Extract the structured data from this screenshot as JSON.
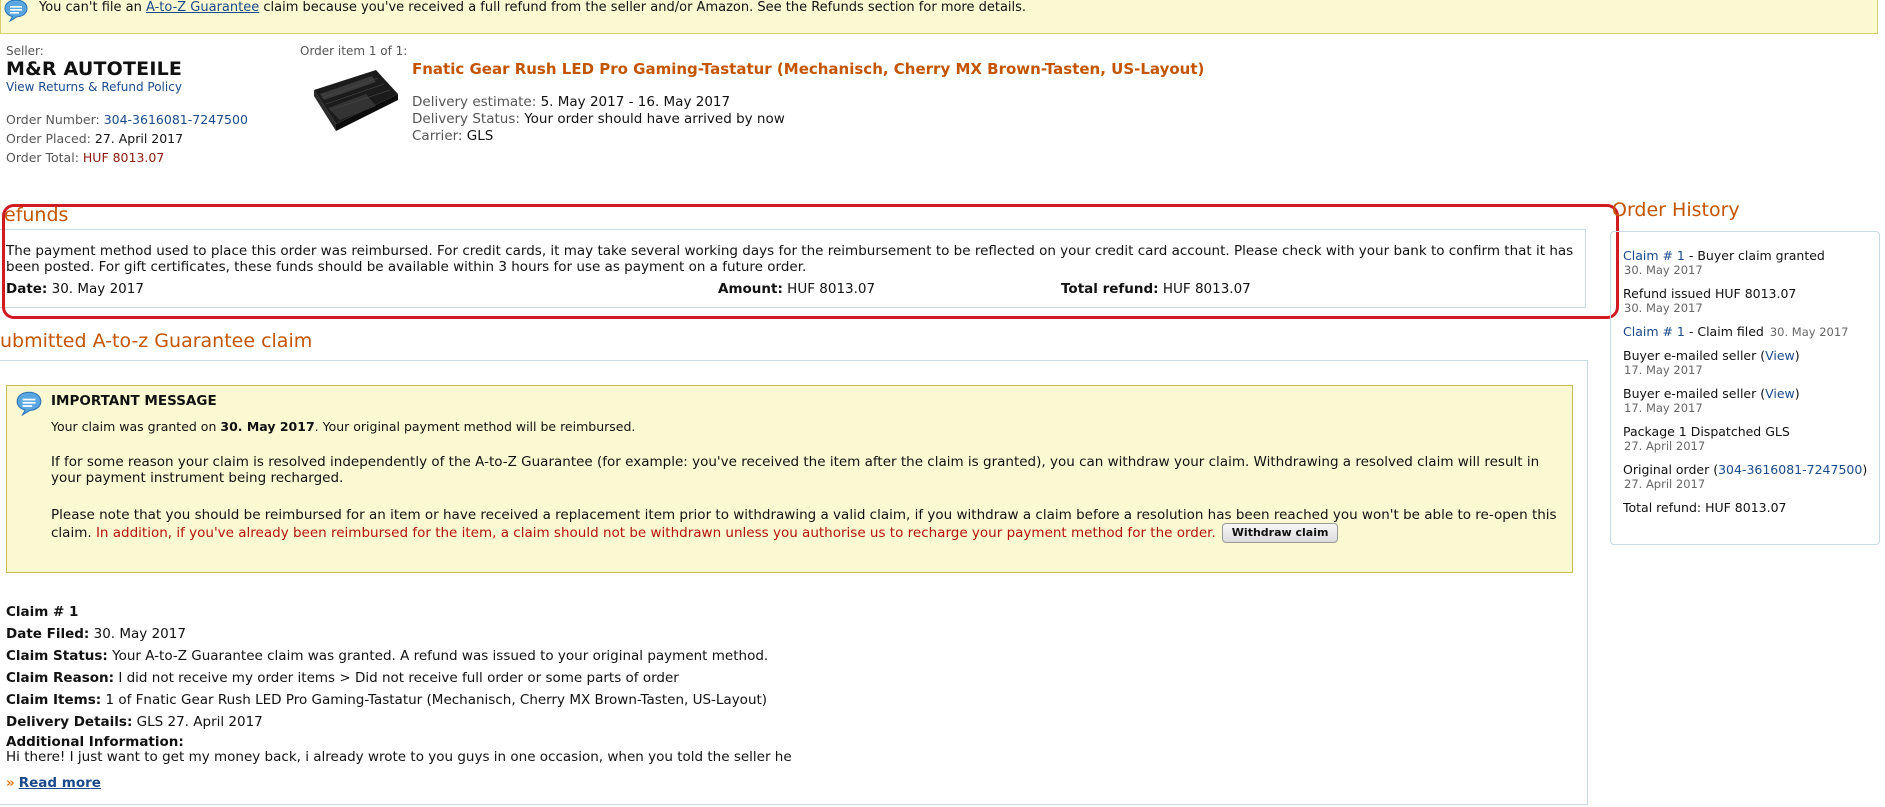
{
  "alert": {
    "prefix": "You can't file an",
    "link": "A-to-Z Guarantee",
    "suffix": "claim because you've received a full refund from the seller and/or Amazon. See the Refunds section for more details."
  },
  "seller": {
    "label": "Seller:",
    "name": "M&R AUTOTEILE",
    "policy_link": "View Returns & Refund Policy",
    "order_number_label": "Order Number:",
    "order_number": "304-3616081-7247500",
    "order_placed_label": "Order Placed:",
    "order_placed": "27. April 2017",
    "order_total_label": "Order Total:",
    "order_total": "HUF 8013.07"
  },
  "order_item": {
    "label": "Order item 1 of 1:",
    "title": "Fnatic Gear Rush LED Pro Gaming-Tastatur (Mechanisch, Cherry MX Brown-Tasten, US-Layout)",
    "delivery_estimate_label": "Delivery estimate:",
    "delivery_estimate": "5. May 2017 - 16. May 2017",
    "delivery_status_label": "Delivery Status:",
    "delivery_status": "Your order should have arrived by now",
    "carrier_label": "Carrier:",
    "carrier": "GLS"
  },
  "refunds": {
    "heading": "efunds",
    "text": "The payment method used to place this order was reimbursed. For credit cards, it may take several working days for the reimbursement to be reflected on your credit card account. Please check with your bank to confirm that it has been posted. For gift certificates, these funds should be available within 3 hours for use as payment on a future order.",
    "date_label": "Date:",
    "date": "30. May 2017",
    "amount_label": "Amount:",
    "amount": "HUF 8013.07",
    "total_label": "Total refund:",
    "total": "HUF 8013.07"
  },
  "claim": {
    "heading": "ubmitted A-to-z Guarantee claim",
    "message_heading": "IMPORTANT MESSAGE",
    "msg1_prefix": "Your claim was granted on",
    "msg1_date": "30. May 2017",
    "msg1_suffix": ". Your original payment method will be reimbursed.",
    "msg2": "If for some reason your claim is resolved independently of the A-to-Z Guarantee (for example: you've received the item after the claim is granted), you can withdraw your claim. Withdrawing a resolved claim will result in your payment instrument being recharged.",
    "msg3": "Please note that you should be reimbursed for an item or have received a replacement item prior to withdrawing a valid claim, if you withdraw a claim before a resolution has been reached you won't be able to re-open this claim.",
    "msg3_red": "In addition, if you've already been reimbursed for the item, a claim should not be withdrawn unless you authorise us to recharge your payment method for the order.",
    "withdraw_button": "Withdraw claim",
    "claim_number": "Claim # 1",
    "date_filed_label": "Date Filed:",
    "date_filed": "30. May 2017",
    "status_label": "Claim Status:",
    "status": "Your A-to-Z Guarantee claim was granted. A refund was issued to your original payment method.",
    "reason_label": "Claim Reason:",
    "reason": "I did not receive my order items > Did not receive full order or some parts of order",
    "items_label": "Claim Items:",
    "items": "1 of Fnatic Gear Rush LED Pro Gaming-Tastatur (Mechanisch, Cherry MX Brown-Tasten, US-Layout)",
    "delivery_label": "Delivery Details:",
    "delivery": "GLS 27. April 2017",
    "additional_label": "Additional Information:",
    "additional": "Hi there! I just want to get my money back, i already wrote to you guys in one occasion, when you told the seller he",
    "read_more": "Read more"
  },
  "history": {
    "heading": "Order History",
    "e1_link": "Claim # 1",
    "e1_text": "- Buyer claim granted",
    "e1_date": "30. May 2017",
    "e2_text": "Refund issued HUF 8013.07",
    "e2_date": "30. May 2017",
    "e3_link": "Claim # 1",
    "e3_text": "- Claim filed",
    "e3_date": "30. May 2017",
    "e4_text": "Buyer e-mailed seller (",
    "e4_link": "View",
    "e4_close": ")",
    "e4_date": "17. May 2017",
    "e5_text": "Buyer e-mailed seller (",
    "e5_link": "View",
    "e5_close": ")",
    "e5_date": "17. May 2017",
    "e6_text": "Package 1 Dispatched GLS",
    "e6_date": "27. April 2017",
    "e7_text": "Original order (",
    "e7_link": "304-3616081-7247500",
    "e7_close": ")",
    "e7_date": "27. April 2017",
    "e8_text": "Total refund: HUF 8013.07"
  },
  "colors": {
    "heading_orange": "#c45500",
    "link_blue": "#1a4a8a",
    "alert_bg": "#fbf9d2",
    "highlight_red": "#d11a22",
    "price_red": "#8b1a0e"
  }
}
